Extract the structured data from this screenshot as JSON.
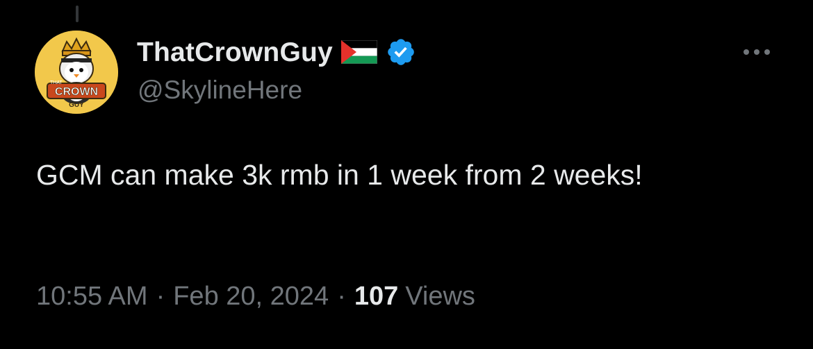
{
  "tweet": {
    "author": {
      "display_name": "ThatCrownGuy",
      "handle": "@SkylineHere",
      "flag_icon": "palestine-flag-icon",
      "verified_icon": "verified-badge-icon",
      "verified_color": "#1d9bf0",
      "avatar_text_top": "THAT",
      "avatar_text_main": "CROWN",
      "avatar_text_bottom": "GUY"
    },
    "text": "GCM can make 3k rmb in 1 week from 2 weeks!",
    "time": "10:55 AM",
    "date": "Feb 20, 2024",
    "separator": "·",
    "views_count": "107",
    "views_label": "Views",
    "more_icon": "more-options-icon"
  },
  "colors": {
    "background": "#000000",
    "primary_text": "#e7e9ea",
    "secondary_text": "#71767b",
    "avatar_background": "#f2c84b"
  }
}
